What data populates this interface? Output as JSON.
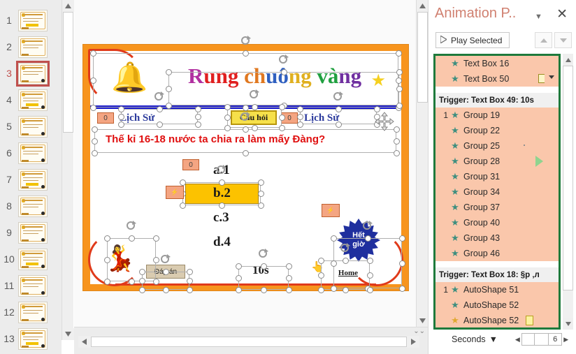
{
  "app": {
    "thumbnails": {
      "slides": [
        {
          "num": "1",
          "active": false
        },
        {
          "num": "2",
          "active": false
        },
        {
          "num": "3",
          "active": true
        },
        {
          "num": "4",
          "active": false
        },
        {
          "num": "5",
          "active": false
        },
        {
          "num": "6",
          "active": false
        },
        {
          "num": "7",
          "active": false
        },
        {
          "num": "8",
          "active": false
        },
        {
          "num": "9",
          "active": false
        },
        {
          "num": "10",
          "active": false
        },
        {
          "num": "11",
          "active": false
        },
        {
          "num": "12",
          "active": false
        },
        {
          "num": "13",
          "active": false
        }
      ]
    },
    "slide": {
      "title_chars": [
        "R",
        "ung",
        " ch",
        "uô",
        "ng",
        " và",
        "ng"
      ],
      "title_full": "Rung chuông vàng",
      "nav_left_label": "Lịch Sử",
      "nav_right_label": "Lịch Sử",
      "center_button": "Câu hỏi",
      "badge_zero": "0",
      "question": "Thế kỉ 16-18 nước ta chia ra làm mấy Đàng?",
      "options": [
        {
          "key": "a",
          "text": "a.1",
          "highlighted": false
        },
        {
          "key": "b",
          "text": "b.2",
          "highlighted": true
        },
        {
          "key": "c",
          "text": "c.3",
          "highlighted": false
        },
        {
          "key": "d",
          "text": "d.4",
          "highlighted": false
        }
      ],
      "answer_button": "Đáp án",
      "timer_label": "10s",
      "timeup_line1": "Hết",
      "timeup_line2": "giờ",
      "home_label": "Home",
      "bell_icon": "bell-icon",
      "fairy_icon": "fairy-icon",
      "star_icon": "star-icon",
      "colors": {
        "frame": "#f7941d",
        "question": "#e01010",
        "highlight": "#fcc200",
        "rule": "#1a1acc",
        "arc": "#e03a1a"
      }
    },
    "animation_pane": {
      "title": "Animation P..",
      "caret_icon": "chevron-down-icon",
      "close_icon": "close-icon",
      "play_selected": "Play Selected",
      "play_icon": "play-icon",
      "reorder_up_icon": "chevron-up-icon",
      "reorder_down_icon": "chevron-down-icon",
      "items": [
        {
          "kind": "anim",
          "seq": "",
          "label": "Text Box 16",
          "star": "green",
          "extra": ""
        },
        {
          "kind": "anim",
          "seq": "",
          "label": "Text Box 50",
          "star": "green",
          "extra": "bracket-caret"
        },
        {
          "kind": "gap"
        },
        {
          "kind": "trigger",
          "label": "Trigger: Text Box 49: 10s"
        },
        {
          "kind": "anim",
          "seq": "1",
          "label": "Group 19",
          "star": "green",
          "extra": ""
        },
        {
          "kind": "anim",
          "seq": "",
          "label": "Group 22",
          "star": "green",
          "extra": ""
        },
        {
          "kind": "anim",
          "seq": "",
          "label": "Group 25",
          "star": "green",
          "extra": "dot"
        },
        {
          "kind": "anim",
          "seq": "",
          "label": "Group 28",
          "star": "green",
          "extra": "green-play"
        },
        {
          "kind": "anim",
          "seq": "",
          "label": "Group 31",
          "star": "green",
          "extra": ""
        },
        {
          "kind": "anim",
          "seq": "",
          "label": "Group 34",
          "star": "green",
          "extra": ""
        },
        {
          "kind": "anim",
          "seq": "",
          "label": "Group 37",
          "star": "green",
          "extra": ""
        },
        {
          "kind": "anim",
          "seq": "",
          "label": "Group 40",
          "star": "green",
          "extra": ""
        },
        {
          "kind": "anim",
          "seq": "",
          "label": "Group 43",
          "star": "green",
          "extra": ""
        },
        {
          "kind": "anim",
          "seq": "",
          "label": "Group 46",
          "star": "green",
          "extra": ""
        },
        {
          "kind": "gap"
        },
        {
          "kind": "trigger",
          "label": "Trigger: Text Box 18: §p ‚л"
        },
        {
          "kind": "anim",
          "seq": "1",
          "label": "AutoShape 51",
          "star": "green",
          "extra": ""
        },
        {
          "kind": "anim",
          "seq": "",
          "label": "AutoShape 52",
          "star": "green",
          "extra": ""
        },
        {
          "kind": "anim",
          "seq": "",
          "label": "AutoShape 52",
          "star": "gold",
          "extra": "yellowbox"
        }
      ],
      "footer": {
        "units_label": "Seconds",
        "units_caret": "chevron-down-icon",
        "scroll_left_icon": "triangle-left-icon",
        "scroll_right_icon": "triangle-right-icon",
        "ruler_ticks": [
          "",
          "",
          "6"
        ]
      }
    }
  }
}
